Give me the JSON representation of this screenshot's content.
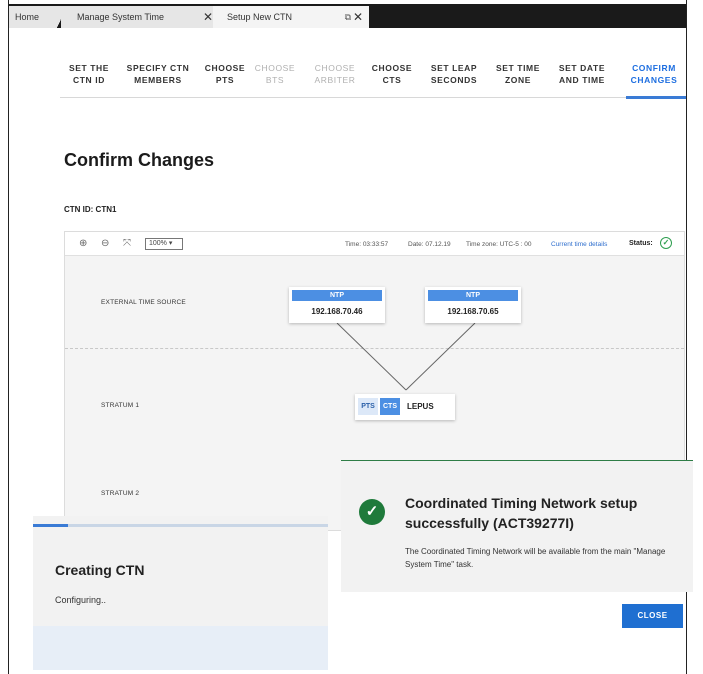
{
  "tabs": [
    {
      "label": "Home"
    },
    {
      "label": "Manage System Time"
    },
    {
      "label": "Setup New CTN"
    }
  ],
  "steps": [
    {
      "label": "SET THE\nCTN ID",
      "state": "done"
    },
    {
      "label": "SPECIFY CTN\nMEMBERS",
      "state": "done"
    },
    {
      "label": "CHOOSE\nPTS",
      "state": "done"
    },
    {
      "label": "CHOOSE\nBTS",
      "state": "disabled"
    },
    {
      "label": "CHOOSE\nARBITER",
      "state": "disabled"
    },
    {
      "label": "CHOOSE\nCTS",
      "state": "done"
    },
    {
      "label": "SET LEAP\nSECONDS",
      "state": "done"
    },
    {
      "label": "SET TIME\nZONE",
      "state": "done"
    },
    {
      "label": "SET DATE\nAND TIME",
      "state": "done"
    },
    {
      "label": "CONFIRM\nCHANGES",
      "state": "active"
    }
  ],
  "page": {
    "title": "Confirm Changes",
    "ctn_id_label": "CTN ID: CTN1"
  },
  "diagram": {
    "zoom": "100%",
    "time": "Time: 03:33:57",
    "date": "Date: 07.12.19",
    "timezone": "Time zone: UTC-5 : 00",
    "time_details_link": "Current time details",
    "status_label": "Status:",
    "rows": {
      "external": "EXTERNAL TIME SOURCE",
      "stratum1": "STRATUM 1",
      "stratum2": "STRATUM 2"
    },
    "ntp_sources": [
      {
        "type": "NTP",
        "ip": "192.168.70.46"
      },
      {
        "type": "NTP",
        "ip": "192.168.70.65"
      }
    ],
    "server": {
      "roles": [
        "PTS",
        "CTS"
      ],
      "name": "LEPUS"
    }
  },
  "notification": {
    "title": "Coordinated Timing Network setup successfully (ACT39277I)",
    "body": "The Coordinated Timing Network will be available from the main \"Manage System Time\" task.",
    "close_label": "CLOSE"
  },
  "creating_modal": {
    "title": "Creating CTN",
    "status": "Configuring..",
    "progress": 0.12
  },
  "colors": {
    "accent": "#1f6fd1",
    "success": "#1f7a3b",
    "ntp_header": "#4c8fe3"
  }
}
